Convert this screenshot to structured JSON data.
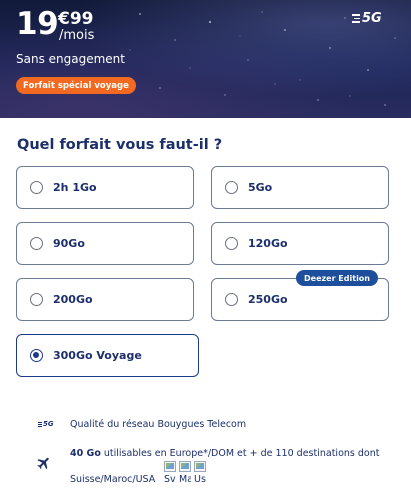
{
  "hero": {
    "price_main": "19",
    "price_cents": "€99",
    "price_period": "/mois",
    "network_badge": "5G",
    "subtitle": "Sans engagement",
    "promo_badge": "Forfait spécial voyage",
    "accent_color": "#f26a21"
  },
  "question": "Quel forfait vous faut-il ?",
  "options": [
    {
      "label": "2h 1Go",
      "selected": false
    },
    {
      "label": "5Go",
      "selected": false
    },
    {
      "label": "90Go",
      "selected": false
    },
    {
      "label": "120Go",
      "selected": false
    },
    {
      "label": "200Go",
      "selected": false
    },
    {
      "label": "250Go",
      "selected": false,
      "tag": "Deezer Edition"
    },
    {
      "label": "300Go Voyage",
      "selected": true
    }
  ],
  "features": {
    "network_icon_label": "5G",
    "network_text": "Qualité du réseau Bouygues Telecom",
    "data_amount": "40 Go",
    "data_text": " utilisables en Europe*/DOM et + de 110 destinations dont",
    "destinations_text": "Suisse/Maroc/USA",
    "flags": [
      {
        "label": "Sv"
      },
      {
        "label": "Ma"
      },
      {
        "label": "Us"
      }
    ]
  },
  "colors": {
    "primary": "#1c2f6b",
    "selected": "#1c3a8a",
    "tag": "#1e4f9c"
  }
}
